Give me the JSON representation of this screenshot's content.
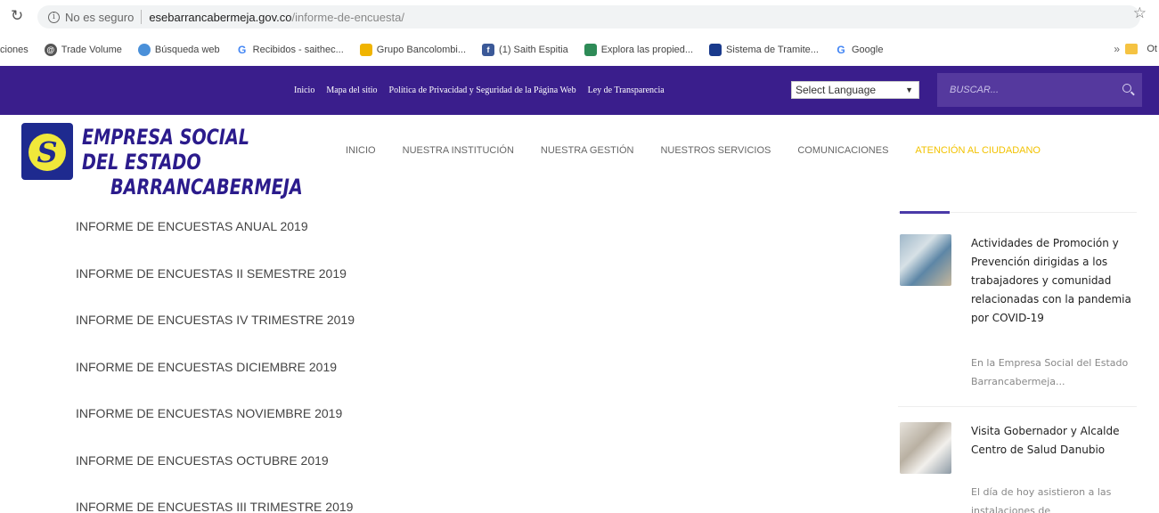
{
  "browser": {
    "security_label": "No es seguro",
    "url_host": "esebarrancabermeja.gov.co",
    "url_path": "/informe-de-encuesta/"
  },
  "bookmarks": [
    {
      "label": "ciones",
      "icon": "none",
      "color": ""
    },
    {
      "label": "Trade Volume",
      "icon": "globe-icon",
      "color": "#555555"
    },
    {
      "label": "Búsqueda web",
      "icon": "search-web-icon",
      "color": "#4a90d9"
    },
    {
      "label": "Recibidos - saithec...",
      "icon": "google-icon",
      "color": "#4285f4"
    },
    {
      "label": "Grupo Bancolombi...",
      "icon": "bancolombia-icon",
      "color": "#f0b400"
    },
    {
      "label": "(1) Saith Espitia",
      "icon": "facebook-icon",
      "color": "#3b5998"
    },
    {
      "label": "Explora las propied...",
      "icon": "home-icon",
      "color": "#2e8b57"
    },
    {
      "label": "Sistema de Tramite...",
      "icon": "system-icon",
      "color": "#1a3a8c"
    },
    {
      "label": "Google",
      "icon": "google-icon",
      "color": "#4285f4"
    }
  ],
  "bookmarks_more": "»",
  "bookmarks_last": "Ot",
  "topbar": {
    "links": [
      "Inicio",
      "Mapa del sitio",
      "Política de Privacidad y Seguridad de la Página Web",
      "Ley de Transparencia"
    ],
    "language": "Select Language",
    "search_placeholder": "BUSCAR..."
  },
  "logo": {
    "glyph": "S",
    "line1": "EMPRESA SOCIAL DEL ESTADO",
    "line2": "BARRANCABERMEJA"
  },
  "nav": [
    "INICIO",
    "NUESTRA INSTITUCIÓN",
    "NUESTRA GESTIÓN",
    "NUESTROS SERVICIOS",
    "COMUNICACIONES",
    "ATENCIÓN AL CIUDADANO"
  ],
  "reports": [
    "INFORME DE ENCUESTAS ANUAL 2019",
    "INFORME DE ENCUESTAS II SEMESTRE 2019",
    "INFORME DE ENCUESTAS IV TRIMESTRE 2019",
    "INFORME DE ENCUESTAS DICIEMBRE 2019",
    "INFORME DE ENCUESTAS NOVIEMBRE 2019",
    "INFORME DE ENCUESTAS OCTUBRE 2019",
    "INFORME DE ENCUESTAS III TRIMESTRE 2019"
  ],
  "sidebar_posts": [
    {
      "title": "Actividades de Promoción y Prevención dirigidas a los trabajadores y comunidad relacionadas con la pandemia por COVID-19",
      "excerpt": "En la Empresa Social del Estado Barrancabermeja..."
    },
    {
      "title": "Visita Gobernador y Alcalde Centro de Salud Danubio",
      "excerpt": "El día de hoy asistieron a las instalaciones de"
    }
  ],
  "colors": {
    "topbar": "#3a1e8c",
    "brand_text": "#2b1b8c",
    "nav_highlight": "#f2c200"
  }
}
